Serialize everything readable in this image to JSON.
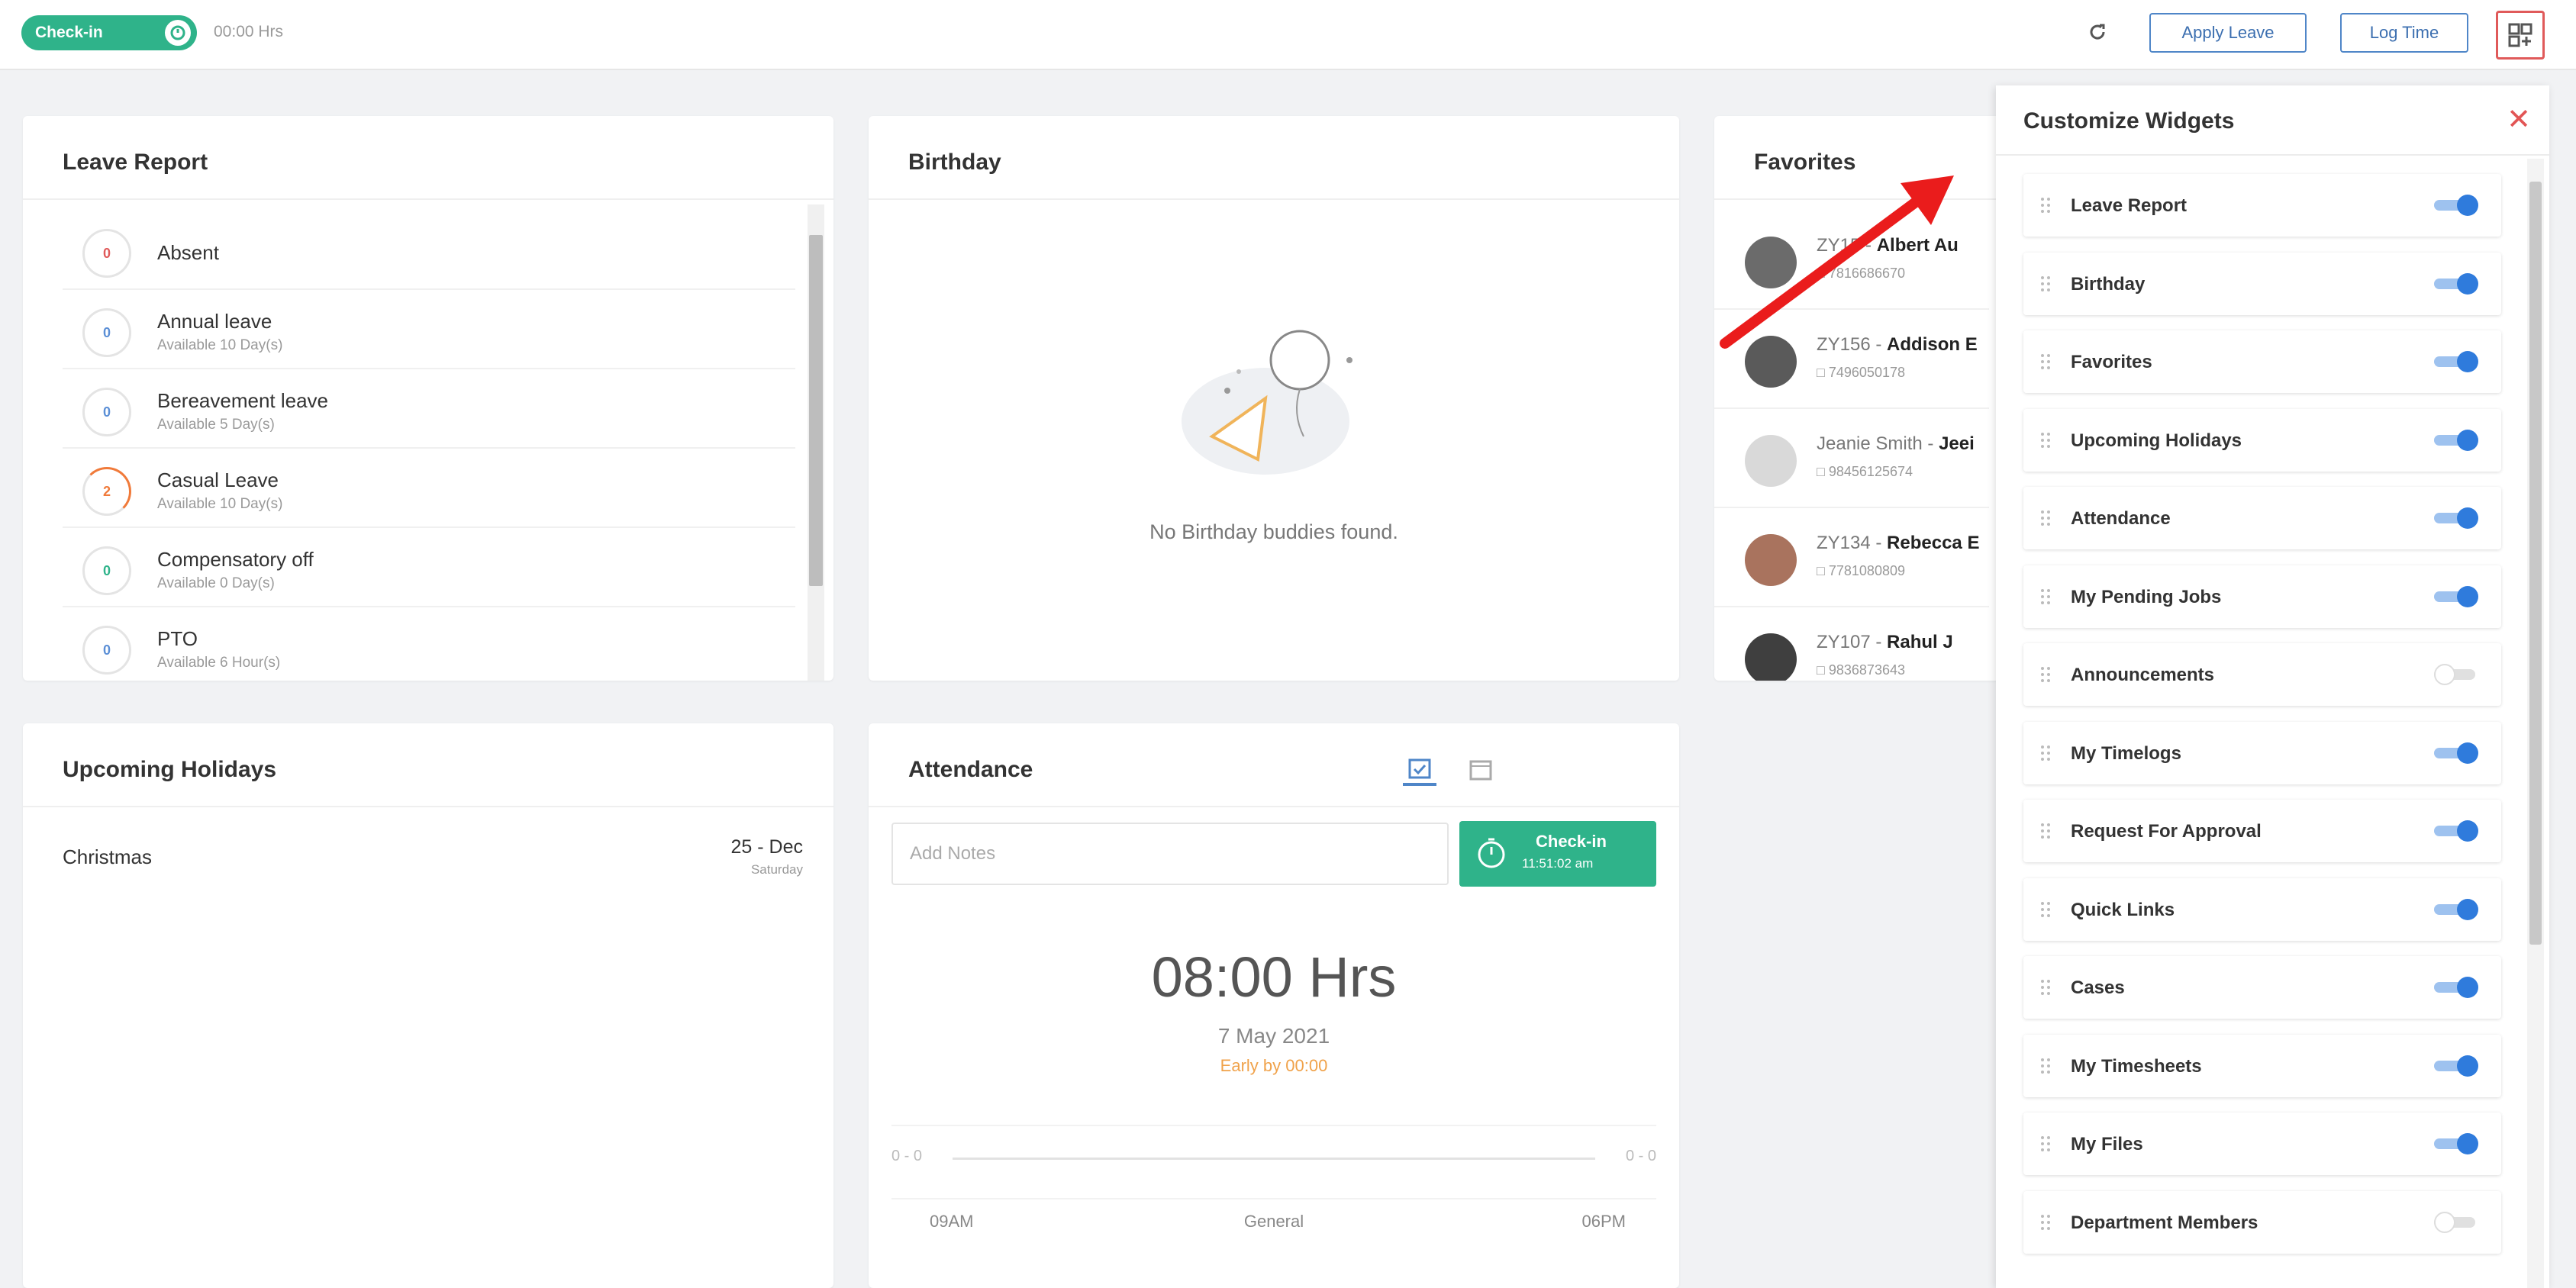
{
  "topbar": {
    "checkin_label": "Check-in",
    "hours": "00:00 Hrs",
    "apply_leave": "Apply Leave",
    "log_time": "Log Time"
  },
  "leave_report": {
    "title": "Leave Report",
    "items": [
      {
        "name": "Absent",
        "available": "",
        "count": "0",
        "color": "#e05a5a"
      },
      {
        "name": "Annual leave",
        "available": "Available 10 Day(s)",
        "count": "0",
        "color": "#5b8fd6"
      },
      {
        "name": "Bereavement leave",
        "available": "Available 5 Day(s)",
        "count": "0",
        "color": "#5b8fd6"
      },
      {
        "name": "Casual Leave",
        "available": "Available 10 Day(s)",
        "count": "2",
        "color": "#f07a3a"
      },
      {
        "name": "Compensatory off",
        "available": "Available 0 Day(s)",
        "count": "0",
        "color": "#2fb38a"
      },
      {
        "name": "PTO",
        "available": "Available 6 Hour(s)",
        "count": "0",
        "color": "#5b8fd6"
      }
    ]
  },
  "birthday": {
    "title": "Birthday",
    "empty_text": "No Birthday buddies found."
  },
  "favorites": {
    "title": "Favorites",
    "items": [
      {
        "id": "ZY15",
        "name": "Albert Au",
        "phone": "7816686670"
      },
      {
        "id": "ZY156",
        "name": "Addison E",
        "phone": "7496050178"
      },
      {
        "id": "Jeanie Smith",
        "name": "Jeei",
        "phone": "98456125674"
      },
      {
        "id": "ZY134",
        "name": "Rebecca E",
        "phone": "7781080809"
      },
      {
        "id": "ZY107",
        "name": "Rahul J",
        "phone": "9836873643"
      }
    ]
  },
  "holidays": {
    "title": "Upcoming Holidays",
    "name": "Christmas",
    "date": "25 - Dec",
    "day": "Saturday"
  },
  "attendance": {
    "title": "Attendance",
    "notes_placeholder": "Add Notes",
    "checkin_label": "Check-in",
    "checkin_time": "11:51:02 am",
    "hours": "08:00 Hrs",
    "date": "7 May 2021",
    "early": "Early by 00:00",
    "start": "09AM",
    "shift": "General",
    "end": "06PM",
    "dot_left": "0 - 0",
    "dot_right": "0 - 0"
  },
  "customize": {
    "title": "Customize Widgets",
    "widgets": [
      {
        "label": "Leave Report",
        "enabled": true
      },
      {
        "label": "Birthday",
        "enabled": true
      },
      {
        "label": "Favorites",
        "enabled": true
      },
      {
        "label": "Upcoming Holidays",
        "enabled": true
      },
      {
        "label": "Attendance",
        "enabled": true
      },
      {
        "label": "My Pending Jobs",
        "enabled": true
      },
      {
        "label": "Announcements",
        "enabled": false
      },
      {
        "label": "My Timelogs",
        "enabled": true
      },
      {
        "label": "Request For Approval",
        "enabled": true
      },
      {
        "label": "Quick Links",
        "enabled": true
      },
      {
        "label": "Cases",
        "enabled": true
      },
      {
        "label": "My Timesheets",
        "enabled": true
      },
      {
        "label": "My Files",
        "enabled": true
      },
      {
        "label": "Department Members",
        "enabled": false
      }
    ]
  },
  "colors": {
    "accent_green": "#2fb38a",
    "toggle_blue": "#2f7bdc",
    "close_red": "#e25555"
  }
}
